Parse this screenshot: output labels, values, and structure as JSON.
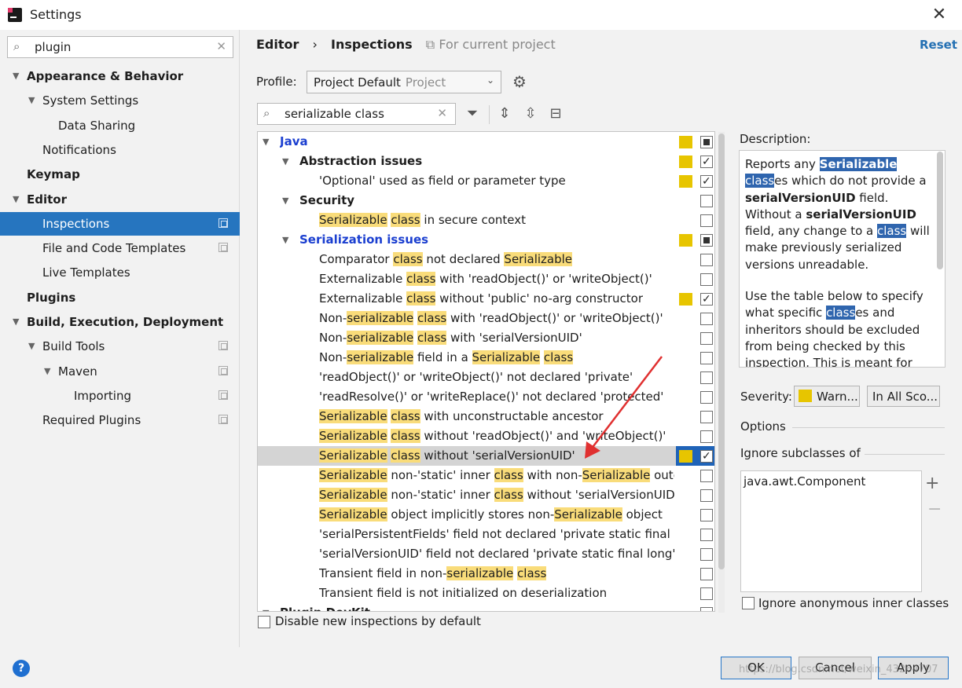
{
  "window": {
    "title": "Settings"
  },
  "sidebar": {
    "search_value": "plugin",
    "items": [
      {
        "label": "Appearance & Behavior",
        "level": 0,
        "expanded": true,
        "bold": true
      },
      {
        "label": "System Settings",
        "level": 1,
        "expanded": true
      },
      {
        "label": "Data Sharing",
        "level": 2
      },
      {
        "label": "Notifications",
        "level": 1
      },
      {
        "label": "Keymap",
        "level": 0,
        "bold": true
      },
      {
        "label": "Editor",
        "level": 0,
        "expanded": true,
        "bold": true
      },
      {
        "label": "Inspections",
        "level": 1,
        "selected": true,
        "copy": true
      },
      {
        "label": "File and Code Templates",
        "level": 1,
        "copy": true
      },
      {
        "label": "Live Templates",
        "level": 1
      },
      {
        "label": "Plugins",
        "level": 0,
        "bold": true
      },
      {
        "label": "Build, Execution, Deployment",
        "level": 0,
        "expanded": true,
        "bold": true
      },
      {
        "label": "Build Tools",
        "level": 1,
        "expanded": true,
        "copy": true
      },
      {
        "label": "Maven",
        "level": 2,
        "expanded": true,
        "copy": true
      },
      {
        "label": "Importing",
        "level": 3,
        "copy": true
      },
      {
        "label": "Required Plugins",
        "level": 1,
        "copy": true
      }
    ]
  },
  "header": {
    "crumb1": "Editor",
    "crumb_sep": "›",
    "crumb2": "Inspections",
    "scope": "For current project",
    "reset": "Reset"
  },
  "profile": {
    "label": "Profile:",
    "value": "Project Default",
    "value_hint": "Project"
  },
  "filter": {
    "value": "serializable class"
  },
  "inspections": [
    {
      "segs": [
        [
          "Java",
          0
        ]
      ],
      "level": 0,
      "arrow": true,
      "group": "blue",
      "sev": true,
      "cb": "mix"
    },
    {
      "segs": [
        [
          "Abstraction issues",
          0
        ]
      ],
      "level": 1,
      "arrow": true,
      "group": "bold",
      "sev": true,
      "cb": "chk"
    },
    {
      "segs": [
        [
          "'Optional' used as field or parameter type",
          0
        ]
      ],
      "level": 2,
      "sev": true,
      "cb": "chk"
    },
    {
      "segs": [
        [
          "Security",
          0
        ]
      ],
      "level": 1,
      "arrow": true,
      "group": "bold",
      "cb": "none"
    },
    {
      "segs": [
        [
          "Serializable",
          1
        ],
        [
          " ",
          0
        ],
        [
          "class",
          1
        ],
        [
          " in secure context",
          0
        ]
      ],
      "level": 2,
      "cb": "none"
    },
    {
      "segs": [
        [
          "Serialization issues",
          0
        ]
      ],
      "level": 1,
      "arrow": true,
      "group": "blue",
      "sev": true,
      "cb": "mix"
    },
    {
      "segs": [
        [
          "Comparator ",
          0
        ],
        [
          "class",
          1
        ],
        [
          " not declared ",
          0
        ],
        [
          "Serializable",
          1
        ]
      ],
      "level": 2,
      "cb": "none"
    },
    {
      "segs": [
        [
          "Externalizable ",
          0
        ],
        [
          "class",
          1
        ],
        [
          " with 'readObject()' or 'writeObject()'",
          0
        ]
      ],
      "level": 2,
      "cb": "none"
    },
    {
      "segs": [
        [
          "Externalizable ",
          0
        ],
        [
          "class",
          1
        ],
        [
          " without 'public' no-arg constructor",
          0
        ]
      ],
      "level": 2,
      "sev": true,
      "cb": "chk"
    },
    {
      "segs": [
        [
          "Non-",
          0
        ],
        [
          "serializable",
          1
        ],
        [
          " ",
          0
        ],
        [
          "class",
          1
        ],
        [
          " with 'readObject()' or 'writeObject()'",
          0
        ]
      ],
      "level": 2,
      "cb": "none"
    },
    {
      "segs": [
        [
          "Non-",
          0
        ],
        [
          "serializable",
          1
        ],
        [
          " ",
          0
        ],
        [
          "class",
          1
        ],
        [
          " with 'serialVersionUID'",
          0
        ]
      ],
      "level": 2,
      "cb": "none"
    },
    {
      "segs": [
        [
          "Non-",
          0
        ],
        [
          "serializable",
          1
        ],
        [
          " field in a ",
          0
        ],
        [
          "Serializable",
          1
        ],
        [
          " ",
          0
        ],
        [
          "class",
          1
        ]
      ],
      "level": 2,
      "cb": "none"
    },
    {
      "segs": [
        [
          "'readObject()' or 'writeObject()' not declared 'private'",
          0
        ]
      ],
      "level": 2,
      "cb": "none"
    },
    {
      "segs": [
        [
          "'readResolve()' or 'writeReplace()' not declared 'protected'",
          0
        ]
      ],
      "level": 2,
      "cb": "none"
    },
    {
      "segs": [
        [
          "Serializable",
          1
        ],
        [
          " ",
          0
        ],
        [
          "class",
          1
        ],
        [
          " with unconstructable ancestor",
          0
        ]
      ],
      "level": 2,
      "cb": "none"
    },
    {
      "segs": [
        [
          "Serializable",
          1
        ],
        [
          " ",
          0
        ],
        [
          "class",
          1
        ],
        [
          " without 'readObject()' and 'writeObject()'",
          0
        ]
      ],
      "level": 2,
      "cb": "none"
    },
    {
      "segs": [
        [
          "Serializable",
          1
        ],
        [
          " ",
          0
        ],
        [
          "class",
          1
        ],
        [
          " without 'serialVersionUID'",
          0
        ]
      ],
      "level": 2,
      "sev": true,
      "cb": "chk",
      "selected": true
    },
    {
      "segs": [
        [
          "Serializable",
          1
        ],
        [
          " non-'static' inner ",
          0
        ],
        [
          "class",
          1
        ],
        [
          " with non-",
          0
        ],
        [
          "Serializable",
          1
        ],
        [
          " outer c",
          0
        ]
      ],
      "level": 2,
      "cb": "none"
    },
    {
      "segs": [
        [
          "Serializable",
          1
        ],
        [
          " non-'static' inner ",
          0
        ],
        [
          "class",
          1
        ],
        [
          " without 'serialVersionUID'",
          0
        ]
      ],
      "level": 2,
      "cb": "none"
    },
    {
      "segs": [
        [
          "Serializable",
          1
        ],
        [
          " object implicitly stores non-",
          0
        ],
        [
          "Serializable",
          1
        ],
        [
          " object",
          0
        ]
      ],
      "level": 2,
      "cb": "none"
    },
    {
      "segs": [
        [
          "'serialPersistentFields' field not declared 'private static final Ob",
          0
        ]
      ],
      "level": 2,
      "cb": "none"
    },
    {
      "segs": [
        [
          "'serialVersionUID' field not declared 'private static final long'",
          0
        ]
      ],
      "level": 2,
      "cb": "none"
    },
    {
      "segs": [
        [
          "Transient field in non-",
          0
        ],
        [
          "serializable",
          1
        ],
        [
          " ",
          0
        ],
        [
          "class",
          1
        ]
      ],
      "level": 2,
      "cb": "none"
    },
    {
      "segs": [
        [
          "Transient field is not initialized on deserialization",
          0
        ]
      ],
      "level": 2,
      "cb": "none"
    },
    {
      "segs": [
        [
          "Plugin DevKit",
          0
        ]
      ],
      "level": 0,
      "arrow": true,
      "group": "bold",
      "cb": "none"
    }
  ],
  "disable_new": "Disable new inspections by default",
  "description": {
    "label": "Description:",
    "p1_a": "Reports any ",
    "p1_b": "Serializable",
    "p1_c": "class",
    "p1_d": "es which do not provide a ",
    "p1_e": "serialVersionUID",
    "p1_f": " field. Without a ",
    "p1_g": "serialVersionUID",
    "p1_h": " field, any change to a ",
    "p1_i": "class",
    "p1_j": " will make previously serialized versions unreadable.",
    "p2_a": "Use the table below to specify what specific ",
    "p2_b": "class",
    "p2_c": "es and inheritors should be excluded from being checked by this inspection. This is meant for"
  },
  "severity": {
    "label": "Severity:",
    "value": "Warn...",
    "scope": "In All Sco..."
  },
  "options": {
    "label": "Options",
    "ignore_label": "Ignore subclasses of",
    "ignore_item": "java.awt.Component",
    "add": "+",
    "remove": "−",
    "anon": "Ignore anonymous inner classes"
  },
  "buttons": {
    "ok": "OK",
    "cancel": "Cancel",
    "apply": "Apply",
    "help": "?"
  },
  "watermark": "https://blog.csdn.net/weixin_43264707",
  "colors": {
    "accent": "#2675bf",
    "severity_warning": "#e7c500",
    "match_highlight": "#f9dc7a",
    "group_blue": "#1b3fd0"
  }
}
